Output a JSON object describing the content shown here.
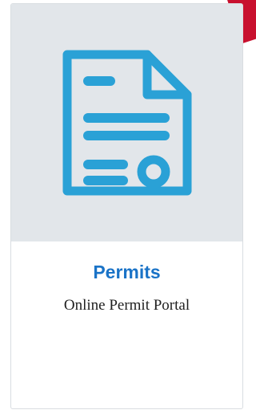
{
  "card": {
    "title": "Permits",
    "subtitle": "Online Permit Portal",
    "icon": "document-icon"
  },
  "colors": {
    "accent": "#1a73c7",
    "icon": "#2aa1d6",
    "media_background": "#e2e6ea",
    "corner_accent": "#c8102e"
  }
}
